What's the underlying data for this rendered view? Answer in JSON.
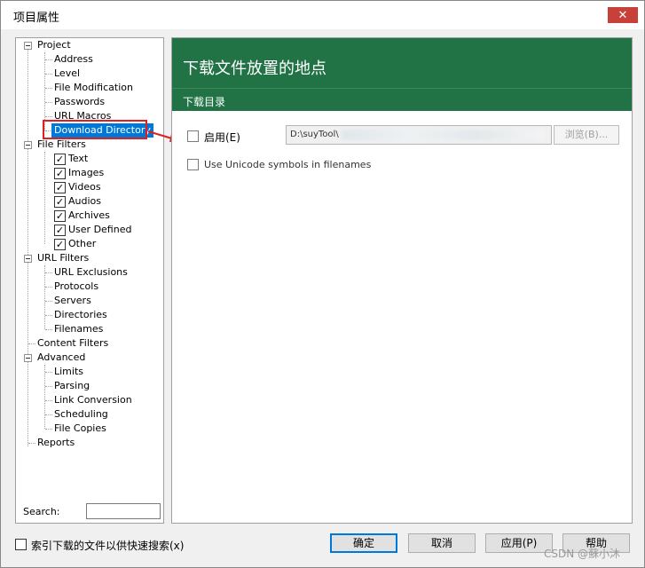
{
  "window": {
    "title": "项目属性",
    "close_glyph": "✕"
  },
  "tree": {
    "project": "Project",
    "project_children": [
      "Address",
      "Level",
      "File Modification",
      "Passwords",
      "URL Macros",
      "Download Directory"
    ],
    "file_filters": "File Filters",
    "file_filters_children": [
      "Text",
      "Images",
      "Videos",
      "Audios",
      "Archives",
      "User Defined",
      "Other"
    ],
    "url_filters": "URL Filters",
    "url_filters_children": [
      "URL Exclusions",
      "Protocols",
      "Servers",
      "Directories",
      "Filenames"
    ],
    "content_filters": "Content Filters",
    "advanced": "Advanced",
    "advanced_children": [
      "Limits",
      "Parsing",
      "Link Conversion",
      "Scheduling",
      "File Copies"
    ],
    "reports": "Reports",
    "selected": "Download Directory"
  },
  "search": {
    "label": "Search:",
    "value": ""
  },
  "content": {
    "title": "下载文件放置的地点",
    "subtitle": "下载目录",
    "enable_label": "启用(E)",
    "path_value": "D:\\suyTool\\",
    "browse_label": "浏览(B)...",
    "unicode_label": "Use Unicode symbols in filenames"
  },
  "footer": {
    "index_label": "索引下载的文件以供快速搜索(x)",
    "ok": "确定",
    "cancel": "取消",
    "apply": "应用(P)",
    "help": "帮助"
  },
  "watermark": "CSDN @蘇小沐",
  "colors": {
    "header": "#217346",
    "selection": "#0078d7",
    "highlight": "#e02020"
  }
}
